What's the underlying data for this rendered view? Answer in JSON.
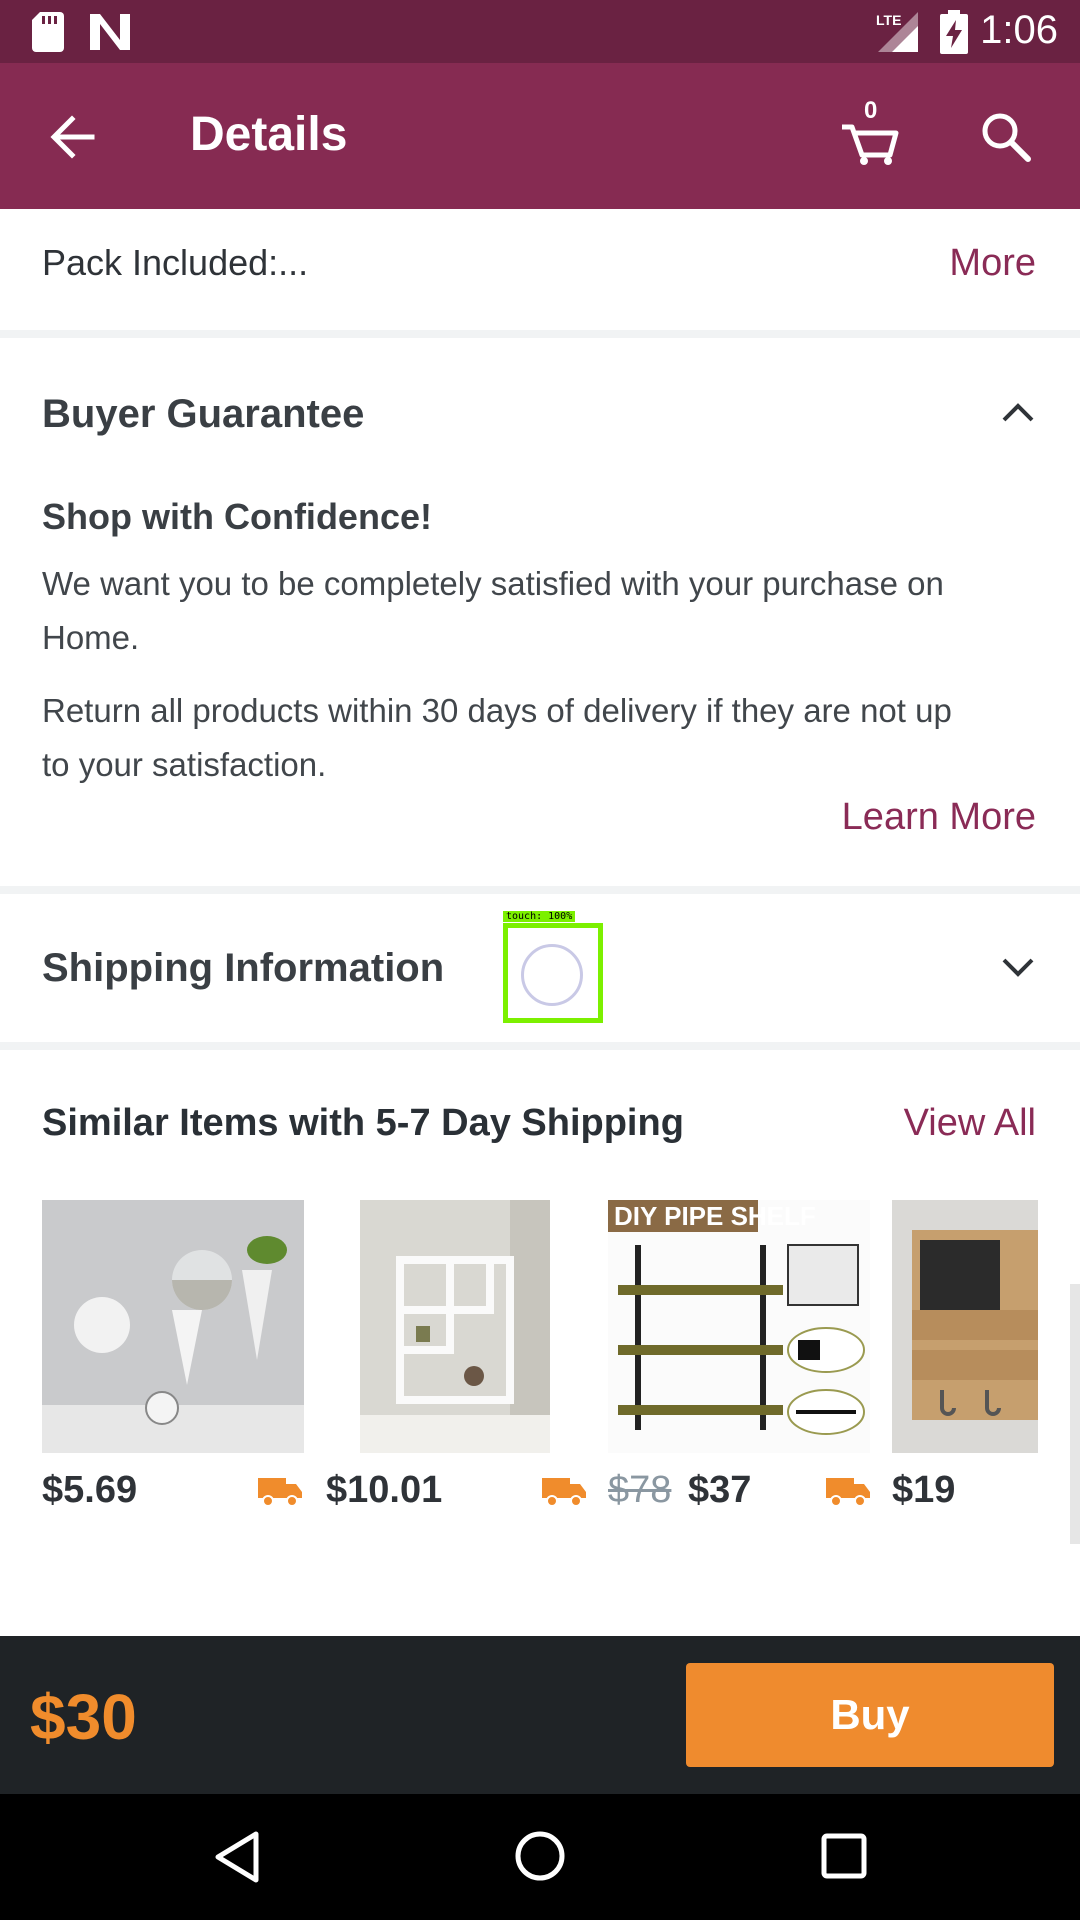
{
  "status_bar": {
    "time": "1:06",
    "network": "LTE"
  },
  "app_bar": {
    "title": "Details",
    "cart_count": "0"
  },
  "pack_included": {
    "text": "Pack Included:...",
    "more": "More"
  },
  "buyer_guarantee": {
    "title": "Buyer Guarantee",
    "subtitle": "Shop with Confidence!",
    "para1_line1": "We want you to be completely satisfied with your purchase on",
    "para1_line2": "Home.",
    "para2_line1": "Return all products within 30 days of delivery if they are not up",
    "para2_line2": "to your satisfaction.",
    "learn_more": "Learn More"
  },
  "shipping": {
    "title": "Shipping Information"
  },
  "touch_indicator": {
    "label": "touch: 100%"
  },
  "similar": {
    "title": "Similar Items with 5-7 Day Shipping",
    "view_all": "View All",
    "items": [
      {
        "price": "$5.69"
      },
      {
        "price": "$10.01"
      },
      {
        "old_price": "$78",
        "price": "$37",
        "image_text": "DIY PIPE SHELF"
      },
      {
        "price": "$19"
      }
    ]
  },
  "bottom": {
    "total": "$30",
    "buy": "Buy"
  },
  "colors": {
    "status_bar": "#6a2242",
    "app_bar": "#862b52",
    "accent_link": "#8a2b56",
    "price_orange": "#ef8b2e",
    "buy_bar": "#1f2326"
  }
}
